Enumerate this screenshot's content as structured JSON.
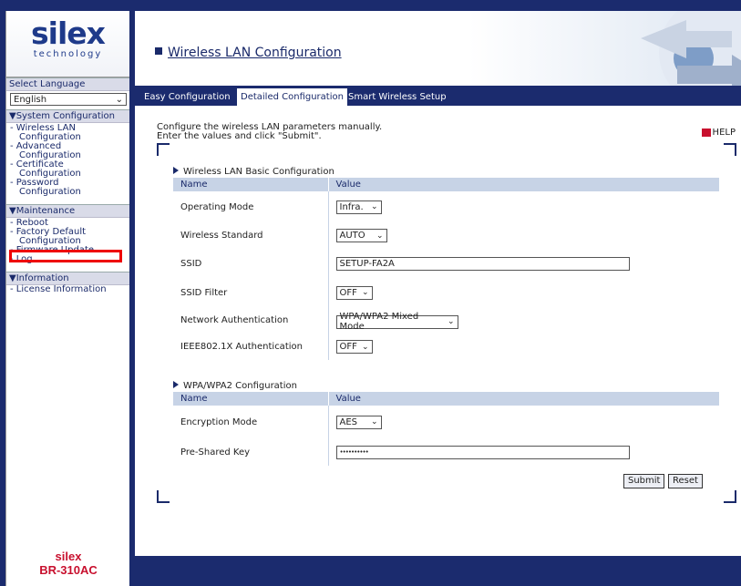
{
  "sidebar": {
    "logo_main": "silex",
    "logo_sub": "technology",
    "select_language_label": "Select Language",
    "language_value": "English",
    "system_heading": "▼System Configuration",
    "system_items": [
      "- Wireless LAN",
      "Configuration",
      "- Advanced",
      "Configuration",
      "- Certificate",
      "Configuration",
      "- Password",
      "Configuration"
    ],
    "maintenance_heading": "▼Maintenance",
    "maintenance_items": [
      "- Reboot",
      "- Factory Default",
      "Configuration",
      "- Firmware Update",
      "- Log"
    ],
    "information_heading": "▼Information",
    "information_items": [
      "- License Information"
    ],
    "product_brand": "silex",
    "product_model": "BR-310AC"
  },
  "header": {
    "title": "Wireless LAN Configuration"
  },
  "tabs": [
    {
      "label": "Easy Configuration",
      "active": false
    },
    {
      "label": "Detailed Configuration",
      "active": true
    },
    {
      "label": "Smart Wireless Setup",
      "active": false
    }
  ],
  "intro": {
    "line1": "Configure the wireless LAN parameters manually.",
    "line2": "Enter the values and click \"Submit\"."
  },
  "help_label": "HELP",
  "basic": {
    "title": "Wireless LAN Basic Configuration",
    "col_name": "Name",
    "col_value": "Value",
    "rows": [
      {
        "name": "Operating Mode",
        "value": "Infra."
      },
      {
        "name": "Wireless Standard",
        "value": "AUTO"
      },
      {
        "name": "SSID",
        "value": "SETUP-FA2A"
      },
      {
        "name": "SSID Filter",
        "value": "OFF"
      },
      {
        "name": "Network Authentication",
        "value": "WPA/WPA2 Mixed Mode"
      },
      {
        "name": "IEEE802.1X Authentication",
        "value": "OFF"
      }
    ]
  },
  "wpa": {
    "title": "WPA/WPA2 Configuration",
    "col_name": "Name",
    "col_value": "Value",
    "rows": [
      {
        "name": "Encryption Mode",
        "value": "AES"
      },
      {
        "name": "Pre-Shared Key",
        "value": "••••••••••"
      }
    ]
  },
  "buttons": {
    "submit": "Submit",
    "reset": "Reset"
  },
  "colors": {
    "navy": "#1b2b6e",
    "brand_red": "#c8102e",
    "header_row": "#c7d3e6"
  }
}
